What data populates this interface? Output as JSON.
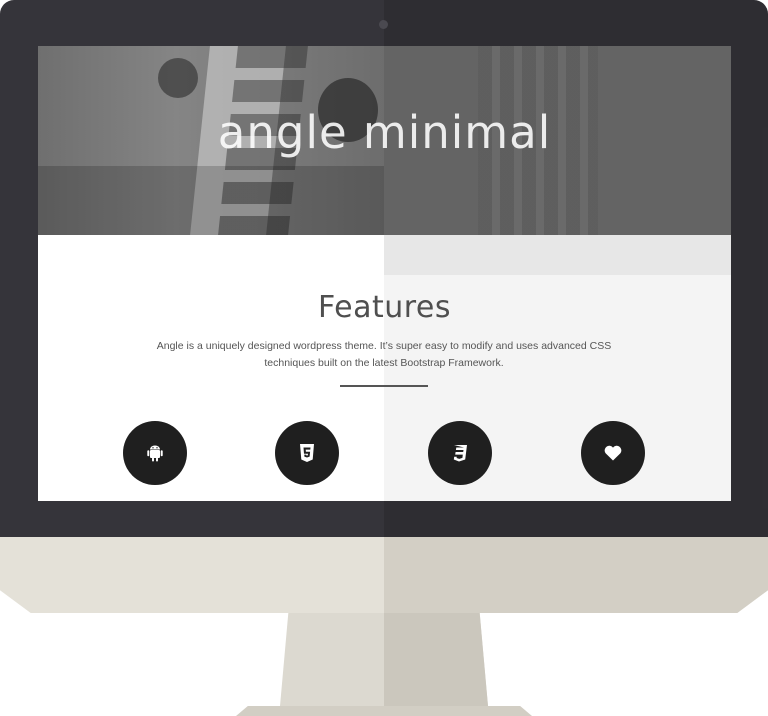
{
  "hero": {
    "title": "angle minimal"
  },
  "features": {
    "title": "Features",
    "description": "Angle is a uniquely designed wordpress theme. It’s super easy to modify and uses advanced CSS techniques built on the latest Bootstrap Framework."
  },
  "icons": [
    {
      "name": "android-icon"
    },
    {
      "name": "html5-icon"
    },
    {
      "name": "css3-icon"
    },
    {
      "name": "heart-icon"
    }
  ],
  "colors": {
    "bezel": "#35343a",
    "chin": "#e4e1d8",
    "icon_bg": "#1f1f1f",
    "text": "#555555"
  }
}
